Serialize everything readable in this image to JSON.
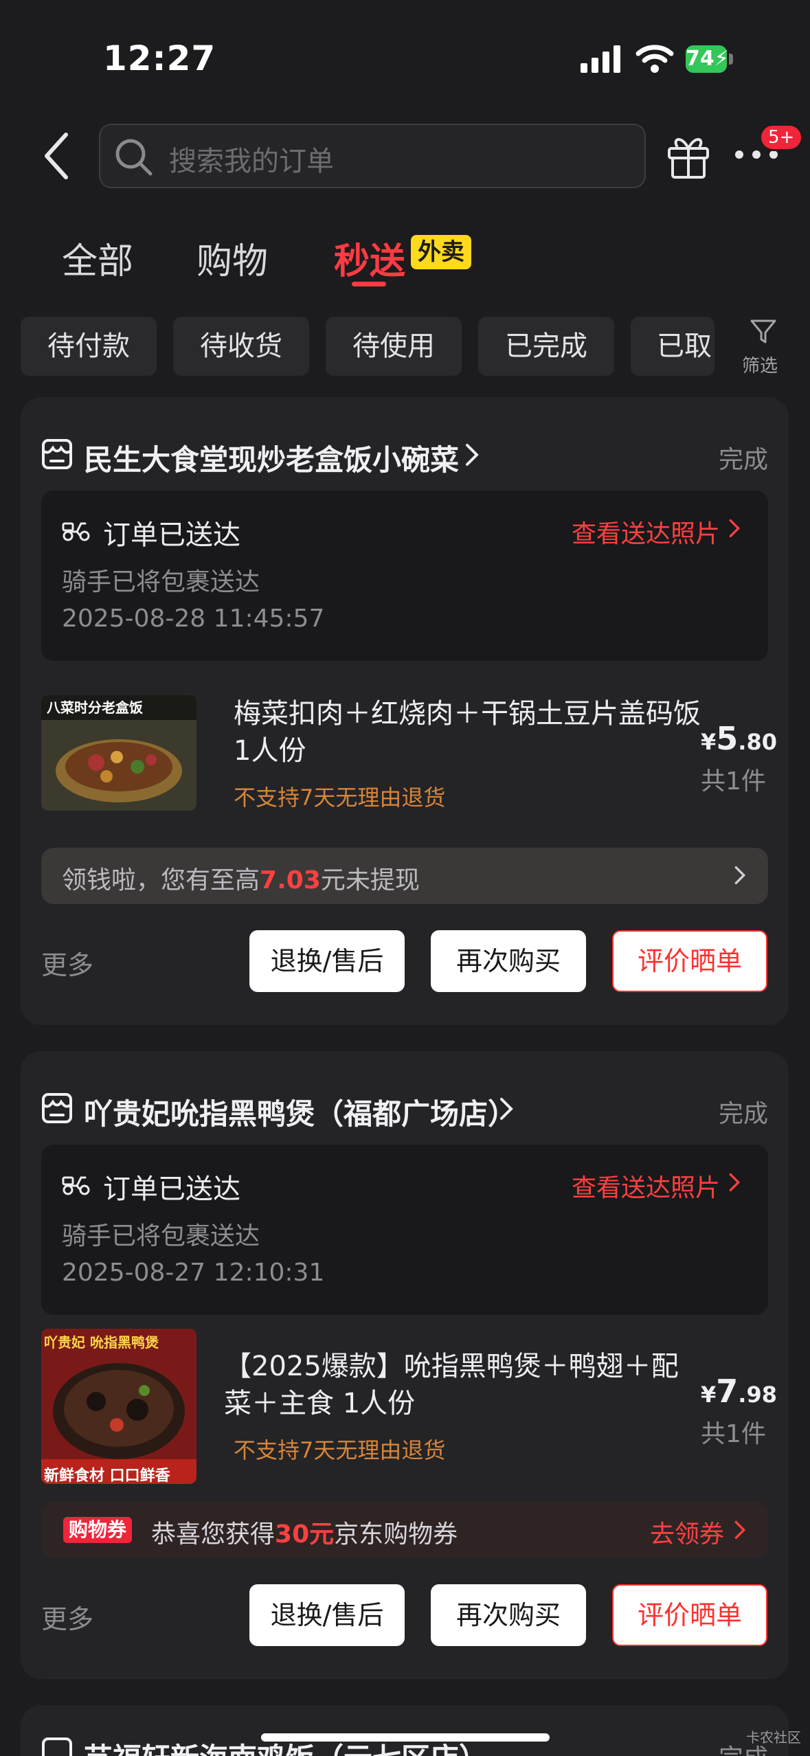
{
  "status_bar": {
    "time": "12:27",
    "battery": "74"
  },
  "header": {
    "search_placeholder": "搜索我的订单",
    "badge": "5+"
  },
  "tabs": [
    {
      "label": "全部"
    },
    {
      "label": "购物"
    },
    {
      "label": "秒送",
      "active": true,
      "tag": "外卖"
    }
  ],
  "filters": {
    "chips": [
      "待付款",
      "待收货",
      "待使用",
      "已完成",
      "已取"
    ],
    "filter_label": "筛选"
  },
  "orders": [
    {
      "shop": "民生大食堂现炒老盒饭小碗菜",
      "status": "完成",
      "delivery": {
        "title": "订单已送达",
        "link": "查看送达照片",
        "sub": "骑手已将包裹送达",
        "time": "2025-08-28 11:45:57"
      },
      "thumb_text": "八菜时分老盒饭",
      "item_title": "梅菜扣肉＋红烧肉＋干锅土豆片盖码饭 1人份",
      "no_return": "不支持7天无理由退货",
      "price": {
        "symbol": "¥",
        "int": "5",
        "dec": ".80"
      },
      "qty": "共1件",
      "promo": {
        "pre": "领钱啦，您有至高",
        "amount": "7.03",
        "post": "元未提现"
      },
      "more": "更多",
      "buttons": [
        "退换/售后",
        "再次购买",
        "评价晒单"
      ]
    },
    {
      "shop": "吖贵妃吮指黑鸭煲（福都广场店）",
      "status": "完成",
      "delivery": {
        "title": "订单已送达",
        "link": "查看送达照片",
        "sub": "骑手已将包裹送达",
        "time": "2025-08-27 12:10:31"
      },
      "thumb_text": "吖贵妃 吮指黑鸭煲",
      "thumb_sub": "新鲜食材 口口鲜香",
      "item_title": "【2025爆款】吮指黑鸭煲＋鸭翅＋配菜＋主食 1人份",
      "no_return": "不支持7天无理由退货",
      "price": {
        "symbol": "¥",
        "int": "7",
        "dec": ".98"
      },
      "qty": "共1件",
      "promo": {
        "tag": "购物券",
        "pre": "恭喜您获得",
        "amount": "30元",
        "post": "京东购物券",
        "link": "去领券"
      },
      "more": "更多",
      "buttons": [
        "退换/售后",
        "再次购买",
        "评价晒单"
      ]
    },
    {
      "shop": "艺福轩新海南鸡饭（云七区店）",
      "status": "完成"
    }
  ],
  "watermark": "卡农社区"
}
